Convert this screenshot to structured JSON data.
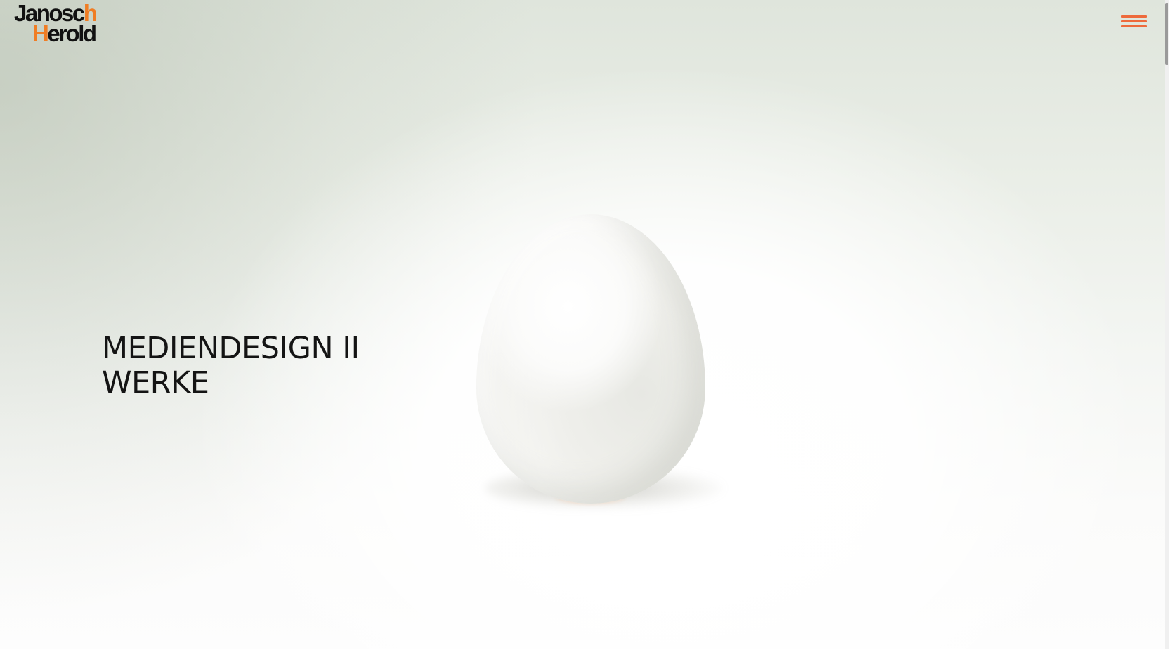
{
  "header": {
    "logo": {
      "first_name_main": "Janosc",
      "first_name_accent": "h",
      "last_name_accent": "H",
      "last_name_main": "erold"
    },
    "menu_icon": "hamburger-menu-icon"
  },
  "hero": {
    "headline_line1": "MEDIENDESIGN II",
    "headline_line2": "WERKE",
    "image_subject": "egg"
  },
  "colors": {
    "accent": "#f07d24",
    "menu": "#ee6a3c",
    "text": "#141414"
  }
}
